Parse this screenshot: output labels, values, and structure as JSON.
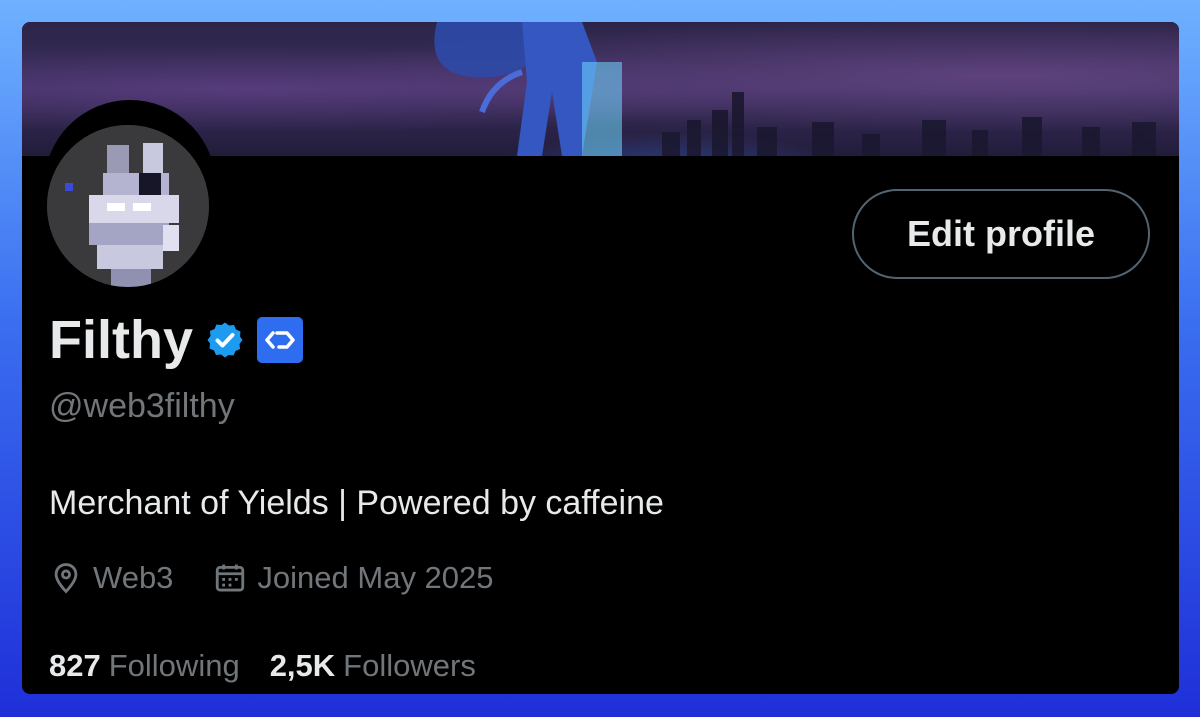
{
  "profile": {
    "display_name": "Filthy",
    "handle": "@web3filthy",
    "bio": "Merchant of Yields | Powered by caffeine",
    "location": "Web3",
    "joined": "Joined May 2025",
    "following_count": "827",
    "following_label": "Following",
    "followers_count": "2,5K",
    "followers_label": "Followers"
  },
  "actions": {
    "edit_profile_label": "Edit profile"
  },
  "icons": {
    "verified": "verified-badge-icon",
    "affiliate": "affiliate-badge-icon",
    "location": "location-pin-icon",
    "calendar": "calendar-icon"
  },
  "colors": {
    "verified_blue": "#1d9bf0",
    "affiliate_blue": "#2f6df0",
    "text_primary": "#e7e9ea",
    "text_secondary": "#71767b"
  }
}
